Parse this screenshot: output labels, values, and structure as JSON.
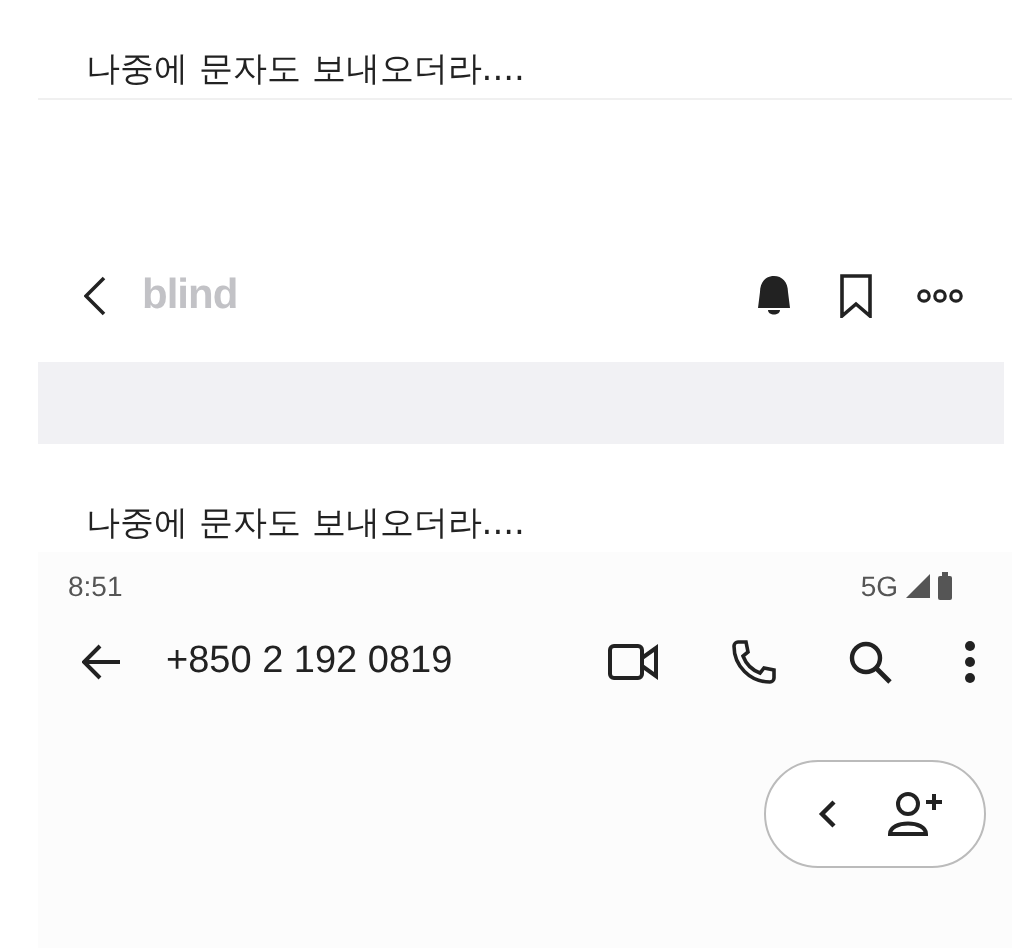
{
  "captions": [
    "나중에 문자도 보내오더라....",
    "나중에 문자도 보내오더라...."
  ],
  "blind_header": {
    "logo": "blind"
  },
  "phone": {
    "status_bar": {
      "time": "8:51",
      "network": "5G"
    },
    "toolbar": {
      "title": "+850 2 192 0819"
    }
  }
}
